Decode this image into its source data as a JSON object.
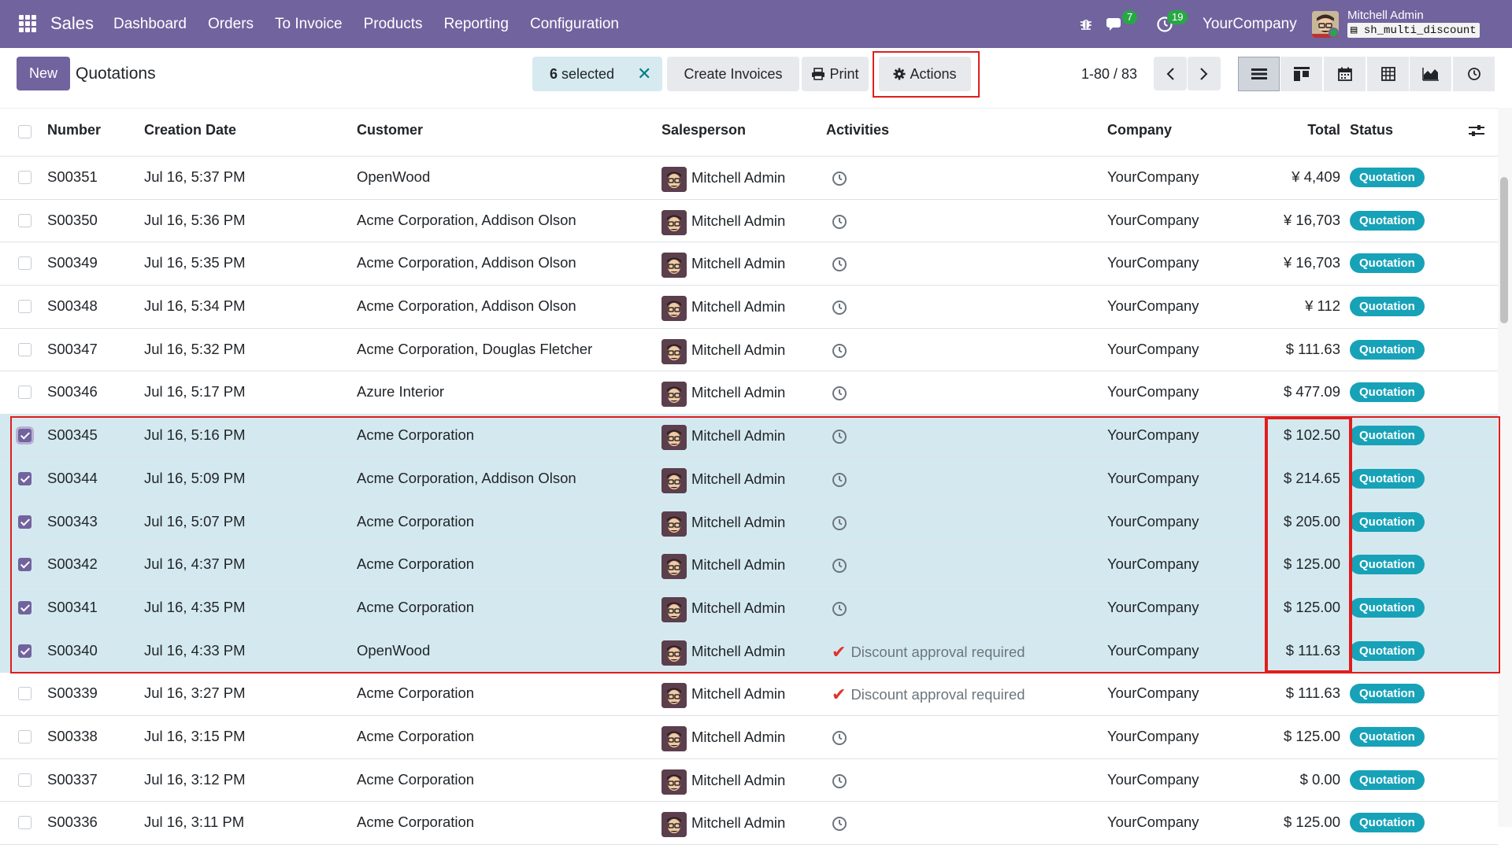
{
  "navbar": {
    "brand": "Sales",
    "menu": [
      "Dashboard",
      "Orders",
      "To Invoice",
      "Products",
      "Reporting",
      "Configuration"
    ],
    "messages_count": "7",
    "activities_count": "19",
    "company": "YourCompany",
    "user": "Mitchell Admin",
    "database": "sh_multi_discount"
  },
  "control": {
    "new_label": "New",
    "breadcrumb": "Quotations",
    "selected_count": "6",
    "selected_label": "selected",
    "create_invoices_label": "Create Invoices",
    "print_label": "Print",
    "actions_label": "Actions",
    "pager": "1-80 / 83"
  },
  "table": {
    "headers": {
      "number": "Number",
      "creation_date": "Creation Date",
      "customer": "Customer",
      "salesperson": "Salesperson",
      "activities": "Activities",
      "company": "Company",
      "total": "Total",
      "status": "Status"
    },
    "rows": [
      {
        "number": "S00351",
        "date": "Jul 16, 5:37 PM",
        "customer": "OpenWood",
        "salesperson": "Mitchell Admin",
        "activity": "",
        "company": "YourCompany",
        "total": "¥ 4,409",
        "status": "Quotation",
        "selected": false
      },
      {
        "number": "S00350",
        "date": "Jul 16, 5:36 PM",
        "customer": "Acme Corporation, Addison Olson",
        "salesperson": "Mitchell Admin",
        "activity": "",
        "company": "YourCompany",
        "total": "¥ 16,703",
        "status": "Quotation",
        "selected": false
      },
      {
        "number": "S00349",
        "date": "Jul 16, 5:35 PM",
        "customer": "Acme Corporation, Addison Olson",
        "salesperson": "Mitchell Admin",
        "activity": "",
        "company": "YourCompany",
        "total": "¥ 16,703",
        "status": "Quotation",
        "selected": false
      },
      {
        "number": "S00348",
        "date": "Jul 16, 5:34 PM",
        "customer": "Acme Corporation, Addison Olson",
        "salesperson": "Mitchell Admin",
        "activity": "",
        "company": "YourCompany",
        "total": "¥ 112",
        "status": "Quotation",
        "selected": false
      },
      {
        "number": "S00347",
        "date": "Jul 16, 5:32 PM",
        "customer": "Acme Corporation, Douglas Fletcher",
        "salesperson": "Mitchell Admin",
        "activity": "",
        "company": "YourCompany",
        "total": "$ 111.63",
        "status": "Quotation",
        "selected": false
      },
      {
        "number": "S00346",
        "date": "Jul 16, 5:17 PM",
        "customer": "Azure Interior",
        "salesperson": "Mitchell Admin",
        "activity": "",
        "company": "YourCompany",
        "total": "$ 477.09",
        "status": "Quotation",
        "selected": false
      },
      {
        "number": "S00345",
        "date": "Jul 16, 5:16 PM",
        "customer": "Acme Corporation",
        "salesperson": "Mitchell Admin",
        "activity": "",
        "company": "YourCompany",
        "total": "$ 102.50",
        "status": "Quotation",
        "selected": true
      },
      {
        "number": "S00344",
        "date": "Jul 16, 5:09 PM",
        "customer": "Acme Corporation, Addison Olson",
        "salesperson": "Mitchell Admin",
        "activity": "",
        "company": "YourCompany",
        "total": "$ 214.65",
        "status": "Quotation",
        "selected": true
      },
      {
        "number": "S00343",
        "date": "Jul 16, 5:07 PM",
        "customer": "Acme Corporation",
        "salesperson": "Mitchell Admin",
        "activity": "",
        "company": "YourCompany",
        "total": "$ 205.00",
        "status": "Quotation",
        "selected": true
      },
      {
        "number": "S00342",
        "date": "Jul 16, 4:37 PM",
        "customer": "Acme Corporation",
        "salesperson": "Mitchell Admin",
        "activity": "",
        "company": "YourCompany",
        "total": "$ 125.00",
        "status": "Quotation",
        "selected": true
      },
      {
        "number": "S00341",
        "date": "Jul 16, 4:35 PM",
        "customer": "Acme Corporation",
        "salesperson": "Mitchell Admin",
        "activity": "",
        "company": "YourCompany",
        "total": "$ 125.00",
        "status": "Quotation",
        "selected": true
      },
      {
        "number": "S00340",
        "date": "Jul 16, 4:33 PM",
        "customer": "OpenWood",
        "salesperson": "Mitchell Admin",
        "activity": "Discount approval required",
        "company": "YourCompany",
        "total": "$ 111.63",
        "status": "Quotation",
        "selected": true
      },
      {
        "number": "S00339",
        "date": "Jul 16, 3:27 PM",
        "customer": "Acme Corporation",
        "salesperson": "Mitchell Admin",
        "activity": "Discount approval required",
        "company": "YourCompany",
        "total": "$ 111.63",
        "status": "Quotation",
        "selected": false
      },
      {
        "number": "S00338",
        "date": "Jul 16, 3:15 PM",
        "customer": "Acme Corporation",
        "salesperson": "Mitchell Admin",
        "activity": "",
        "company": "YourCompany",
        "total": "$ 125.00",
        "status": "Quotation",
        "selected": false
      },
      {
        "number": "S00337",
        "date": "Jul 16, 3:12 PM",
        "customer": "Acme Corporation",
        "salesperson": "Mitchell Admin",
        "activity": "",
        "company": "YourCompany",
        "total": "$ 0.00",
        "status": "Quotation",
        "selected": false
      },
      {
        "number": "S00336",
        "date": "Jul 16, 3:11 PM",
        "customer": "Acme Corporation",
        "salesperson": "Mitchell Admin",
        "activity": "",
        "company": "YourCompany",
        "total": "$ 125.00",
        "status": "Quotation",
        "selected": false
      }
    ]
  },
  "colors": {
    "navbar": "#71639e",
    "selected_row": "#d4e9ef",
    "status_badge": "#17a2b8",
    "highlight": "#e11d1d",
    "activity_check": "#e0332e"
  }
}
